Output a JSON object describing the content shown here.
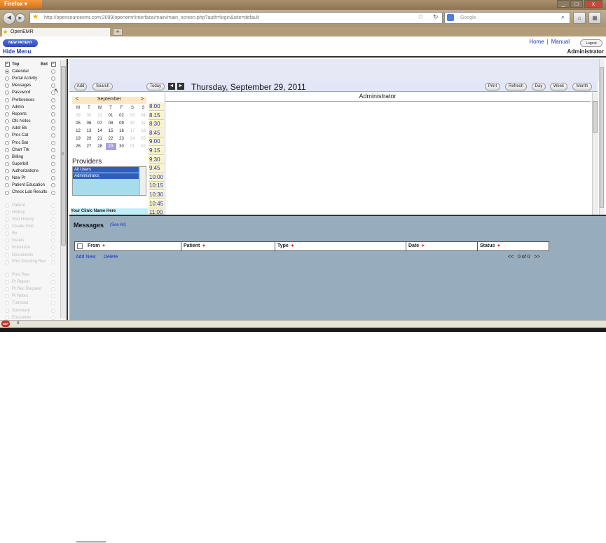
{
  "browser": {
    "app_label": "Firefox",
    "url": "http://opensourceemr.com:2099/openemr/interface/main/main_screen.php?auth=login&site=default",
    "search_placeholder": "Google",
    "tab_title": "OpenEMR",
    "new_tab": "+",
    "window_buttons": [
      "_",
      "□",
      "x"
    ]
  },
  "topbar": {
    "new_patient": "NEW PATIENT",
    "hide_menu": "Hide Menu",
    "home": "Home",
    "sep": "|",
    "manual": "Manual",
    "logout": "Logout",
    "user": "Administrator"
  },
  "leftnav": {
    "top_label": "Top",
    "bot_label": "Bot",
    "items": [
      {
        "label": "Calendar",
        "selected": true,
        "enabled": true
      },
      {
        "label": "Portal Activity",
        "enabled": true
      },
      {
        "label": "Messages",
        "enabled": true
      },
      {
        "label": "Password",
        "enabled": true
      },
      {
        "label": "Preferences",
        "enabled": true
      },
      {
        "label": "Admin",
        "enabled": true
      },
      {
        "label": "Reports",
        "enabled": true
      },
      {
        "label": "Ofc Notes",
        "enabled": true
      },
      {
        "label": "Addr Bk",
        "enabled": true
      },
      {
        "label": "Prnc Cat",
        "enabled": true
      },
      {
        "label": "Prnc Bat",
        "enabled": true
      },
      {
        "label": "Chart Trk",
        "enabled": true
      },
      {
        "label": "Billing",
        "enabled": true
      },
      {
        "label": "Superbill",
        "enabled": true
      },
      {
        "label": "Authorizations",
        "enabled": true
      },
      {
        "label": "New Pt",
        "enabled": true
      },
      {
        "label": "Patient Education",
        "enabled": true
      },
      {
        "label": "Check Lab Results",
        "enabled": true
      },
      {
        "label": "Patient",
        "enabled": false
      },
      {
        "label": "History",
        "enabled": false
      },
      {
        "label": "Visit History",
        "enabled": false
      },
      {
        "label": "Create Visit",
        "enabled": false
      },
      {
        "label": "Rx",
        "enabled": false
      },
      {
        "label": "Issues",
        "enabled": false
      },
      {
        "label": "Immunize",
        "enabled": false
      },
      {
        "label": "Documents",
        "enabled": false
      },
      {
        "label": "Prnc Pending Rev",
        "enabled": false
      },
      {
        "label": "Prnc Res",
        "enabled": false
      },
      {
        "label": "Pt Report",
        "enabled": false
      },
      {
        "label": "Pt Rec Request",
        "enabled": false
      },
      {
        "label": "Pt Notes",
        "enabled": false
      },
      {
        "label": "Transact",
        "enabled": false
      },
      {
        "label": "Summary",
        "enabled": false
      },
      {
        "label": "Encounter",
        "enabled": false
      }
    ]
  },
  "calendar": {
    "add": "Add",
    "search": "Search",
    "today": "Today",
    "prev": "◄",
    "next": "►",
    "date_title": "Thursday, September 29, 2011",
    "print": "Print",
    "refresh": "Refresh",
    "day": "Day",
    "week": "Week",
    "month": "Month",
    "provider_column": "Administrator",
    "times": [
      "8:00",
      "8:15",
      "8:30",
      "8:45",
      "9:00",
      "9:15",
      "9:30",
      "9:45",
      "10:00",
      "10:15",
      "10:30",
      "10:45",
      "11:00"
    ]
  },
  "minical": {
    "prev": "<",
    "month": "September",
    "next": ">",
    "weekdays": [
      "M",
      "T",
      "W",
      "T",
      "F",
      "S",
      "S"
    ],
    "weeks": [
      [
        "29",
        "30",
        "31",
        "01",
        "02",
        "03",
        "04"
      ],
      [
        "05",
        "06",
        "07",
        "08",
        "09",
        "10",
        "11"
      ],
      [
        "12",
        "13",
        "14",
        "15",
        "16",
        "17",
        "18"
      ],
      [
        "19",
        "20",
        "21",
        "22",
        "23",
        "24",
        "25"
      ],
      [
        "26",
        "27",
        "28",
        "29",
        "30",
        "01",
        "02"
      ]
    ],
    "today": "29"
  },
  "providers": {
    "title": "Providers",
    "options": [
      "All Users",
      "Administrator,"
    ]
  },
  "clinic": {
    "name": "Your Clinic Name Here"
  },
  "messages": {
    "title": "Messages",
    "see_all": "(See All)",
    "columns": [
      "From",
      "Patient",
      "Type",
      "Date",
      "Status"
    ],
    "add_new": "Add New",
    "delete": "Delete",
    "pager_prev": "<<",
    "pager_text": "0 of 0",
    "pager_next": ">>"
  },
  "statusbar": {
    "icon": "SBP",
    "close": "x"
  }
}
